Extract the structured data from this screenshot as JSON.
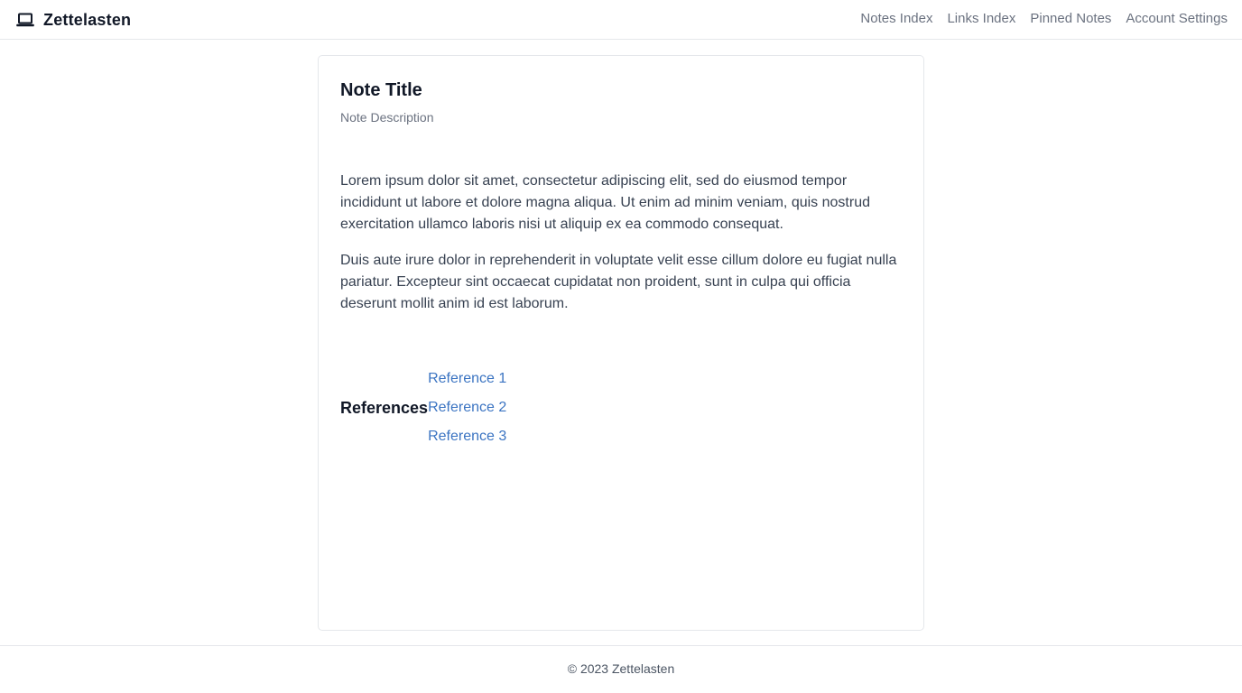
{
  "brand": {
    "icon": "laptop-icon",
    "name": "Zettelasten"
  },
  "nav": {
    "links": [
      {
        "label": "Notes Index"
      },
      {
        "label": "Links Index"
      },
      {
        "label": "Pinned Notes"
      },
      {
        "label": "Account Settings"
      }
    ]
  },
  "note": {
    "title": "Note Title",
    "description": "Note Description",
    "paragraphs": [
      "Lorem ipsum dolor sit amet, consectetur adipiscing elit, sed do eiusmod tempor incididunt ut labore et dolore magna aliqua. Ut enim ad minim veniam, quis nostrud exercitation ullamco laboris nisi ut aliquip ex ea commodo consequat.",
      "Duis aute irure dolor in reprehenderit in voluptate velit esse cillum dolore eu fugiat nulla pariatur. Excepteur sint occaecat cupidatat non proident, sunt in culpa qui officia deserunt mollit anim id est laborum."
    ]
  },
  "references": {
    "heading": "References",
    "items": [
      {
        "label": "Reference 1"
      },
      {
        "label": "Reference 2"
      },
      {
        "label": "Reference 3"
      }
    ]
  },
  "footer": {
    "text": "© 2023 Zettelasten"
  },
  "colors": {
    "link": "#3b74c2",
    "muted": "#6b7280",
    "border": "#e5e7eb",
    "text": "#111827"
  }
}
